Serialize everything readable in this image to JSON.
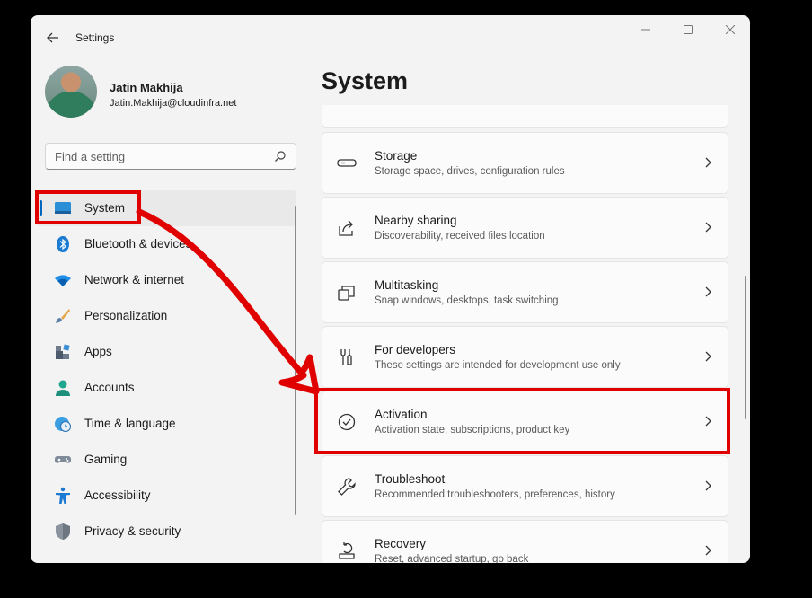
{
  "window": {
    "title": "Settings",
    "accent": "#0067c0",
    "annotation_color": "#e00000"
  },
  "user": {
    "name": "Jatin Makhija",
    "email": "Jatin.Makhija@cloudinfra.net"
  },
  "search": {
    "placeholder": "Find a setting"
  },
  "sidebar": {
    "items": [
      {
        "label": "System",
        "icon": "system-icon",
        "selected": true
      },
      {
        "label": "Bluetooth & devices",
        "icon": "bluetooth-icon"
      },
      {
        "label": "Network & internet",
        "icon": "wifi-icon"
      },
      {
        "label": "Personalization",
        "icon": "brush-icon"
      },
      {
        "label": "Apps",
        "icon": "apps-icon"
      },
      {
        "label": "Accounts",
        "icon": "accounts-icon"
      },
      {
        "label": "Time & language",
        "icon": "globe-clock-icon"
      },
      {
        "label": "Gaming",
        "icon": "gamepad-icon"
      },
      {
        "label": "Accessibility",
        "icon": "accessibility-icon"
      },
      {
        "label": "Privacy & security",
        "icon": "shield-icon"
      }
    ]
  },
  "main": {
    "title": "System",
    "cards": [
      {
        "title": "Storage",
        "subtitle": "Storage space, drives, configuration rules",
        "icon": "storage-icon"
      },
      {
        "title": "Nearby sharing",
        "subtitle": "Discoverability, received files location",
        "icon": "share-icon"
      },
      {
        "title": "Multitasking",
        "subtitle": "Snap windows, desktops, task switching",
        "icon": "multitasking-icon"
      },
      {
        "title": "For developers",
        "subtitle": "These settings are intended for development use only",
        "icon": "developer-tools-icon"
      },
      {
        "title": "Activation",
        "subtitle": "Activation state, subscriptions, product key",
        "icon": "activation-check-icon",
        "highlighted": true
      },
      {
        "title": "Troubleshoot",
        "subtitle": "Recommended troubleshooters, preferences, history",
        "icon": "wrench-icon"
      },
      {
        "title": "Recovery",
        "subtitle": "Reset, advanced startup, go back",
        "icon": "recovery-icon"
      }
    ]
  }
}
